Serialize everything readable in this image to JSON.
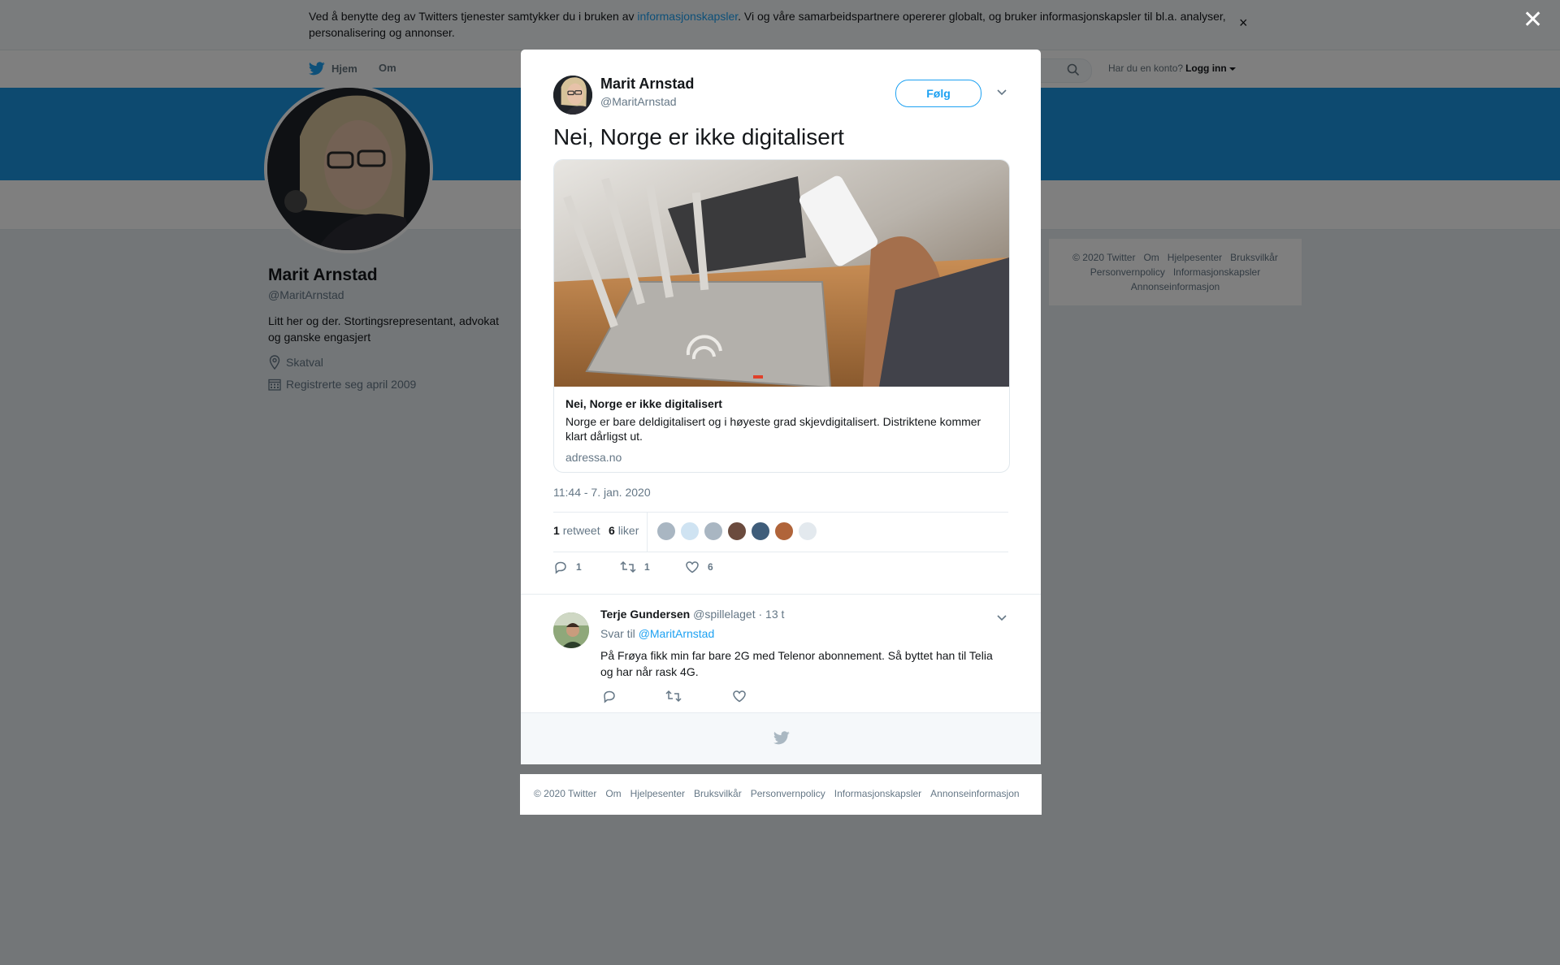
{
  "cookie": {
    "text_before": "Ved å benytte deg av Twitters tjenester samtykker du i bruken av ",
    "link": "informasjonskapsler",
    "text_after": ". Vi og våre samarbeidspartnere opererer globalt, og bruker informasjonskapsler til bl.a. analyser, personalisering og annonser.",
    "close": "×"
  },
  "nav": {
    "home": "Hjem",
    "about": "Om",
    "account_prompt": "Har du en konto?",
    "login": "Logg inn"
  },
  "profile": {
    "name": "Marit Arnstad",
    "handle": "@MaritArnstad",
    "bio": "Litt her og der. Stortingsrepresentant, advokat og ganske engasjert",
    "location": "Skatval",
    "joined": "Registrerte seg april 2009"
  },
  "side_footer": {
    "items": [
      "© 2020 Twitter",
      "Om",
      "Hjelpesenter",
      "Bruksvilkår",
      "Personvernpolicy",
      "Informasjonskapsler",
      "Annonseinformasjon"
    ]
  },
  "overlay": {
    "close": "✕"
  },
  "tweet": {
    "name": "Marit Arnstad",
    "handle": "@MaritArnstad",
    "follow": "Følg",
    "text": "Nei, Norge er ikke digitalisert",
    "card": {
      "title": "Nei, Norge er ikke digitalisert",
      "description": "Norge er bare deldigitalisert og i høyeste grad skjevdigitalisert. Distriktene kommer klart dårligst ut.",
      "domain": "adressa.no"
    },
    "timestamp": "11:44 - 7. jan. 2020",
    "retweets_count": "1",
    "retweets_label": "retweet",
    "likes_count": "6",
    "likes_label": "liker",
    "likers": [
      "#a9b6c2",
      "#cfe3f2",
      "#a9b6c2",
      "#6b4b3e",
      "#3f5d7a",
      "#b0643a",
      "#e3e9ee"
    ],
    "actions": {
      "replies": "1",
      "retweets": "1",
      "likes": "6"
    }
  },
  "reply": {
    "name": "Terje Gundersen",
    "handle": "@spillelaget",
    "time": "· 13 t",
    "replying_to_label": "Svar til",
    "replying_to": "@MaritArnstad",
    "text": "På Frøya fikk min far bare 2G med Telenor abonnement. Så byttet han til Telia og har når rask 4G."
  },
  "bottom_footer": {
    "items": [
      "© 2020 Twitter",
      "Om",
      "Hjelpesenter",
      "Bruksvilkår",
      "Personvernpolicy",
      "Informasjonskapsler",
      "Annonseinformasjon"
    ]
  },
  "colors": {
    "brand_blue": "#1da1f2",
    "banner_blue": "#1b95e0",
    "text_dark": "#14171a",
    "text_muted": "#657786"
  }
}
